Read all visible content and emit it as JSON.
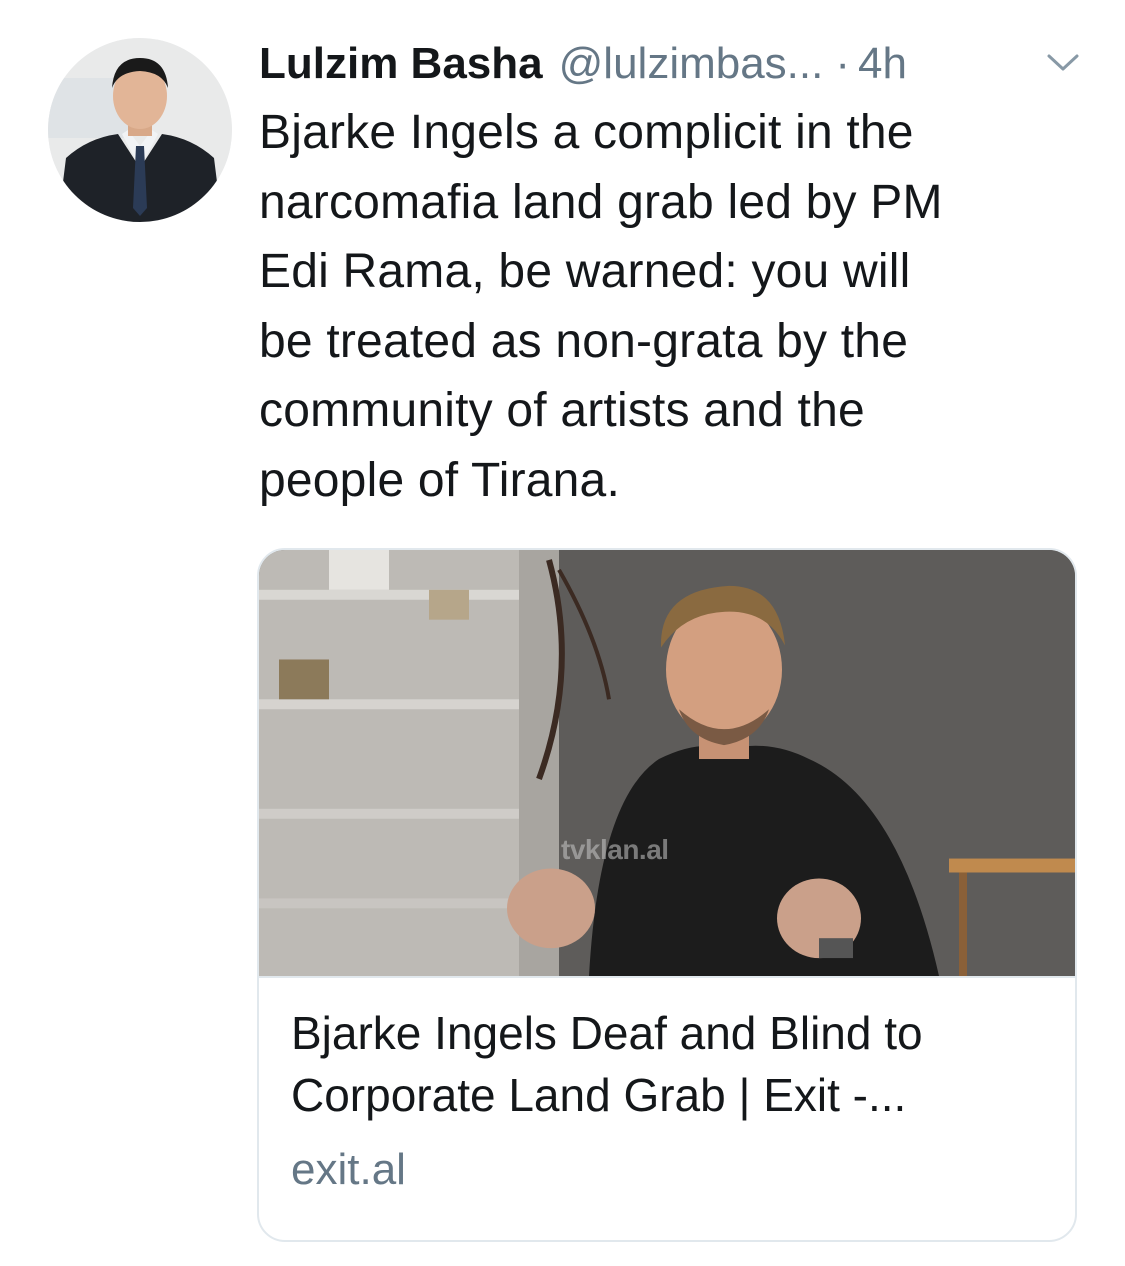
{
  "tweet": {
    "author": {
      "display_name": "Lulzim Basha",
      "handle": "@lulzimbas...",
      "avatar_icon": "profile-photo"
    },
    "separator": "·",
    "time": "4h",
    "menu_icon": "chevron-down-icon",
    "text_lines": [
      "Bjarke Ingels a complicit in the",
      "narcomafia land grab led by PM",
      "Edi Rama, be warned: you will",
      "be treated as non-grata by the",
      "community of artists and the",
      "people of Tirana."
    ],
    "card": {
      "image_watermark": "tvklan.al",
      "title_lines": [
        "Bjarke Ingels Deaf and Blind to",
        "Corporate Land Grab | Exit -..."
      ],
      "domain": "exit.al"
    }
  },
  "colors": {
    "primary_text": "#14171a",
    "secondary_text": "#657786",
    "border": "#e1e8ed"
  }
}
